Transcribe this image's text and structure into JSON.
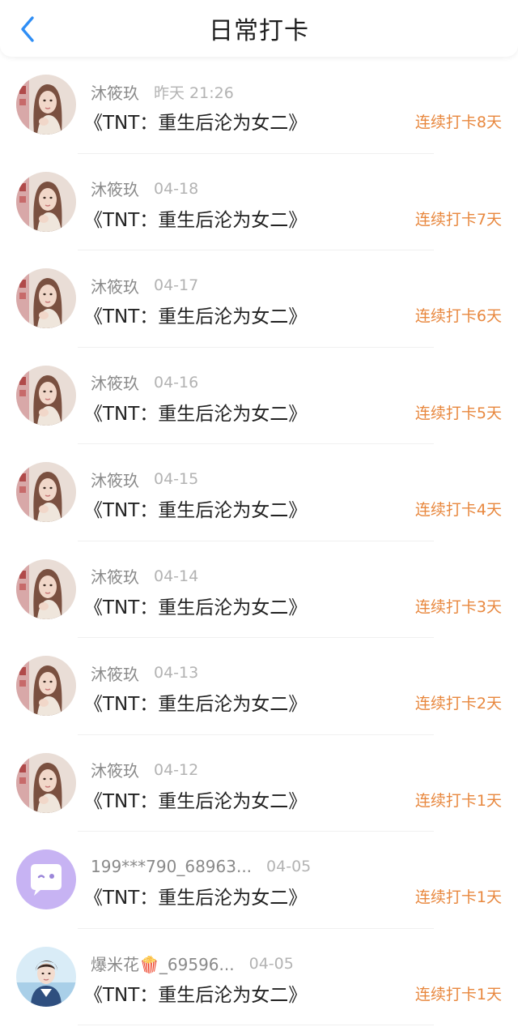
{
  "header": {
    "title": "日常打卡"
  },
  "colors": {
    "accent_back": "#2f8ef5",
    "streak": "#e8883f",
    "avatar_purple": "#c7b3f3"
  },
  "items": [
    {
      "name": "沐筱玖",
      "date": "昨天 21:26",
      "title": "《TNT：重生后沦为女二》",
      "streak": "连续打卡8天",
      "avatar": "photo-girl-avatar"
    },
    {
      "name": "沐筱玖",
      "date": "04-18",
      "title": "《TNT：重生后沦为女二》",
      "streak": "连续打卡7天",
      "avatar": "photo-girl-avatar"
    },
    {
      "name": "沐筱玖",
      "date": "04-17",
      "title": "《TNT：重生后沦为女二》",
      "streak": "连续打卡6天",
      "avatar": "photo-girl-avatar"
    },
    {
      "name": "沐筱玖",
      "date": "04-16",
      "title": "《TNT：重生后沦为女二》",
      "streak": "连续打卡5天",
      "avatar": "photo-girl-avatar"
    },
    {
      "name": "沐筱玖",
      "date": "04-15",
      "title": "《TNT：重生后沦为女二》",
      "streak": "连续打卡4天",
      "avatar": "photo-girl-avatar"
    },
    {
      "name": "沐筱玖",
      "date": "04-14",
      "title": "《TNT：重生后沦为女二》",
      "streak": "连续打卡3天",
      "avatar": "photo-girl-avatar"
    },
    {
      "name": "沐筱玖",
      "date": "04-13",
      "title": "《TNT：重生后沦为女二》",
      "streak": "连续打卡2天",
      "avatar": "photo-girl-avatar"
    },
    {
      "name": "沐筱玖",
      "date": "04-12",
      "title": "《TNT：重生后沦为女二》",
      "streak": "连续打卡1天",
      "avatar": "photo-girl-avatar"
    },
    {
      "name": "199***790_68963...",
      "date": "04-05",
      "title": "《TNT：重生后沦为女二》",
      "streak": "连续打卡1天",
      "avatar": "chat-bubble-avatar"
    },
    {
      "name": "爆米花🍿_69596...",
      "date": "04-05",
      "title": "《TNT：重生后沦为女二》",
      "streak": "连续打卡1天",
      "avatar": "photo-boy-avatar"
    }
  ]
}
